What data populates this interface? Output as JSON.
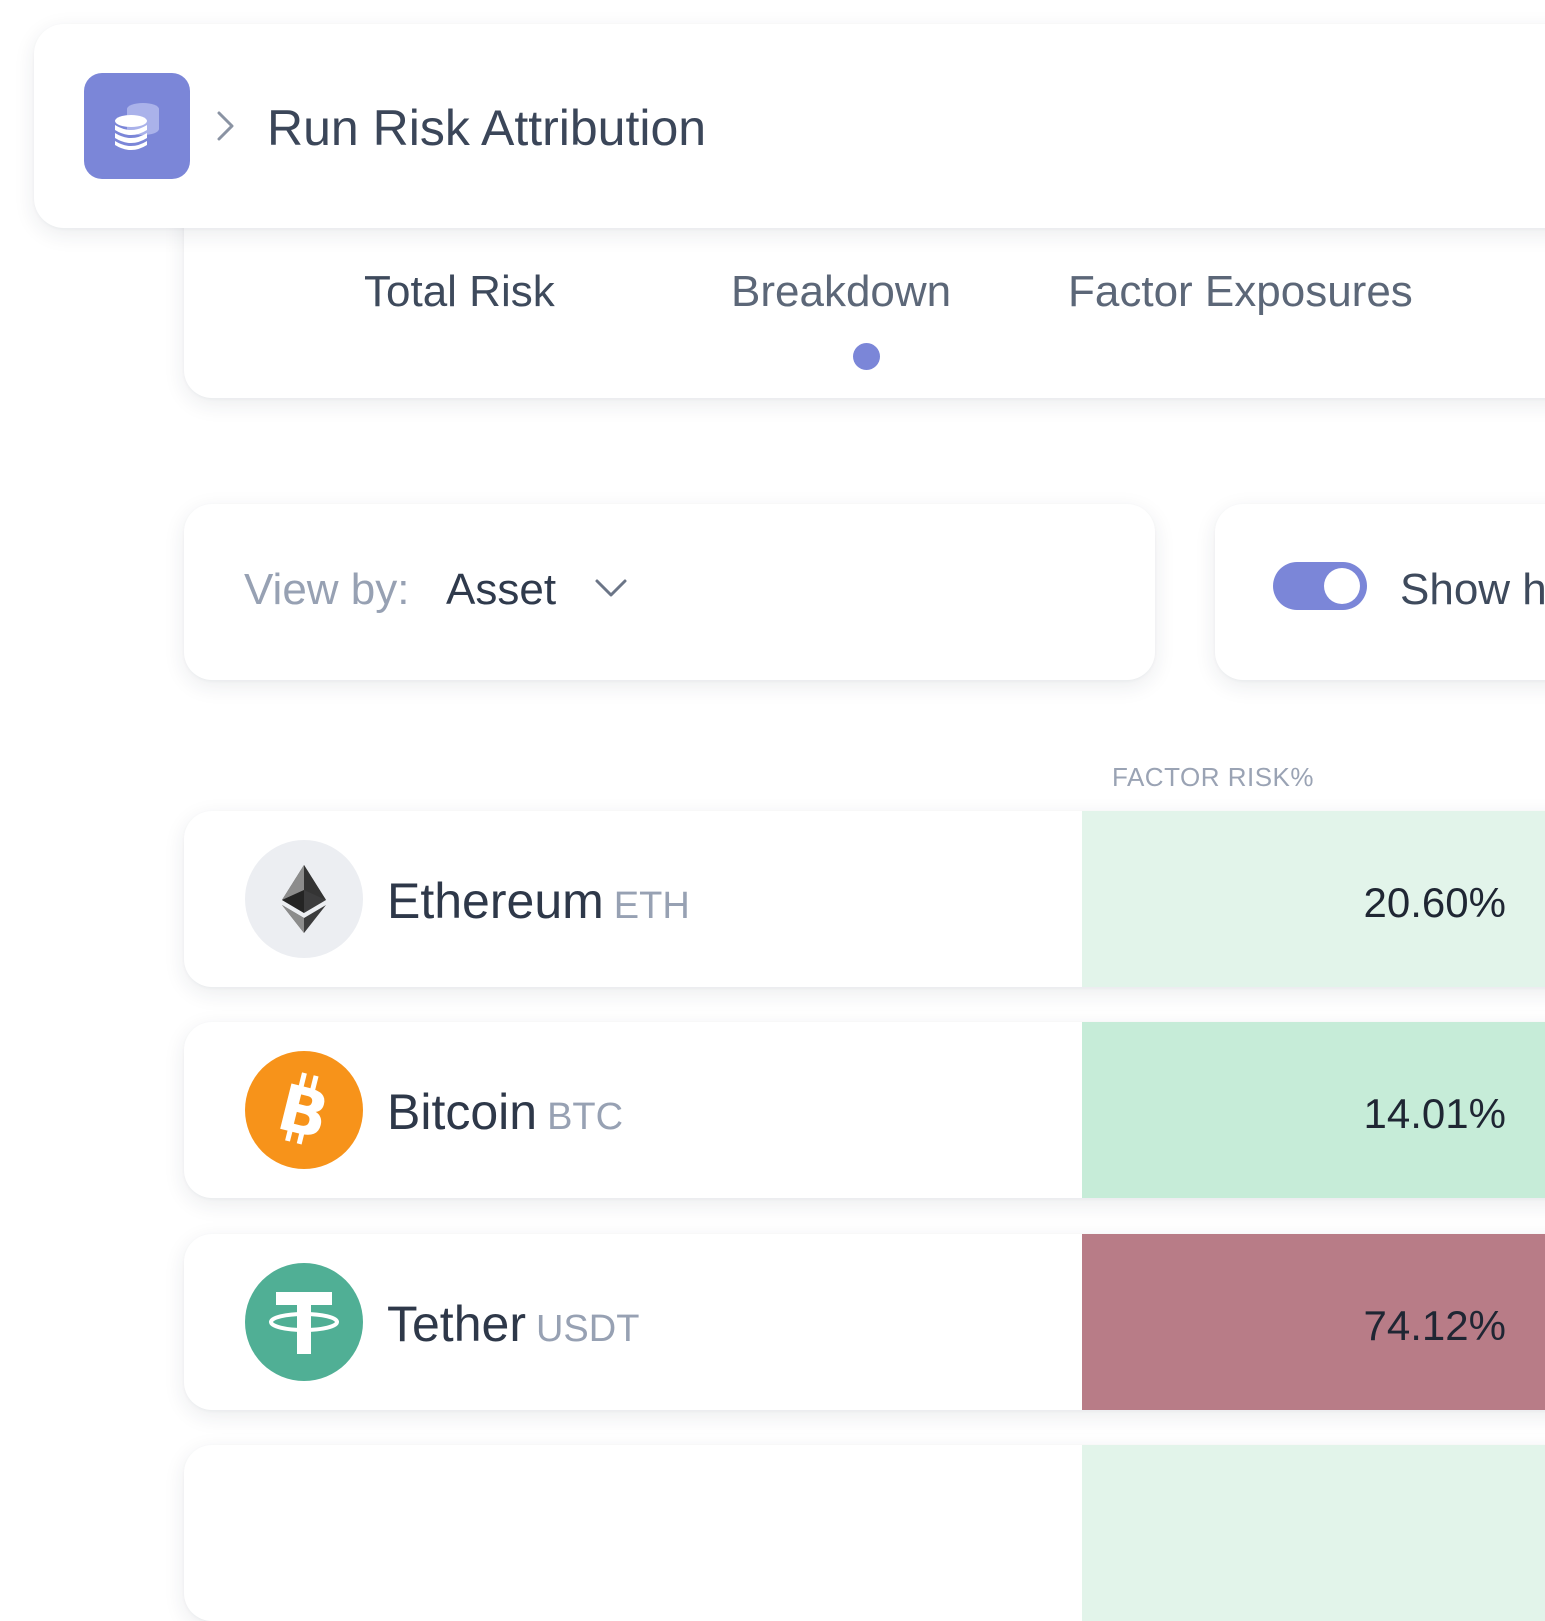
{
  "header": {
    "title": "Run Risk Attribution",
    "icon": "coins-stack-icon",
    "accent_color": "#7b86d8"
  },
  "tabs": [
    {
      "label": "Total Risk",
      "active": false
    },
    {
      "label": "Breakdown",
      "active": true
    },
    {
      "label": "Factor Exposures",
      "active": false
    }
  ],
  "view_by": {
    "label": "View by:",
    "value": "Asset"
  },
  "toggle": {
    "label": "Show h",
    "on": true
  },
  "table": {
    "column_header": "FACTOR RISK%",
    "rows": [
      {
        "name": "Ethereum",
        "ticker": "ETH",
        "factor_risk": "20.60%",
        "cell_color": "#e2f4ea",
        "icon": "ethereum-icon"
      },
      {
        "name": "Bitcoin",
        "ticker": "BTC",
        "factor_risk": "14.01%",
        "cell_color": "#c6ecd8",
        "icon": "bitcoin-icon"
      },
      {
        "name": "Tether",
        "ticker": "USDT",
        "factor_risk": "74.12%",
        "cell_color": "#b87c87",
        "icon": "tether-icon"
      }
    ]
  }
}
